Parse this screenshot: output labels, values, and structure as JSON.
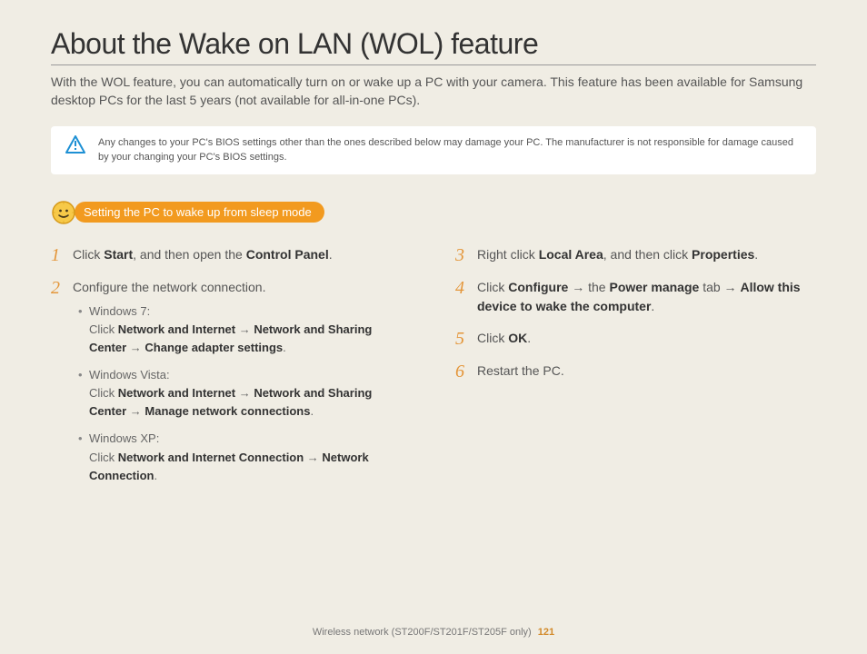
{
  "title": "About the Wake on LAN (WOL) feature",
  "intro": "With the WOL feature, you can automatically turn on or wake up a PC with your camera. This feature has been available for Samsung desktop PCs for the last 5 years (not available for all-in-one PCs).",
  "warning": "Any changes to your PC's BIOS settings other than the ones described below may damage your PC. The manufacturer is not responsible for damage caused by your changing your PC's BIOS settings.",
  "section_heading": "Setting the PC to wake up from sleep mode",
  "left_steps": {
    "s1": {
      "num": "1",
      "pre": "Click ",
      "b1": "Start",
      "mid": ", and then open the ",
      "b2": "Control Panel",
      "post": "."
    },
    "s2": {
      "num": "2",
      "text": "Configure the network connection.",
      "subs": [
        {
          "os": "Windows 7:",
          "pre": "Click ",
          "b1": "Network and Internet",
          "a1": " → ",
          "b2": "Network and Sharing Center",
          "a2": " → ",
          "b3": "Change adapter settings",
          "post": "."
        },
        {
          "os": "Windows Vista:",
          "pre": "Click ",
          "b1": "Network and Internet",
          "a1": " → ",
          "b2": "Network and Sharing Center",
          "a2": " → ",
          "b3": "Manage network connections",
          "post": "."
        },
        {
          "os": "Windows XP:",
          "pre": "Click ",
          "b1": "Network and Internet Connection",
          "a1": " → ",
          "b2": "Network Connection",
          "a2": "",
          "b3": "",
          "post": "."
        }
      ]
    }
  },
  "right_steps": {
    "s3": {
      "num": "3",
      "pre": "Right click ",
      "b1": "Local Area",
      "mid": ", and then click ",
      "b2": "Properties",
      "post": "."
    },
    "s4": {
      "num": "4",
      "pre": "Click ",
      "b1": "Configure",
      "a1": " → the ",
      "b2": "Power manage",
      "a2": " tab → ",
      "b3": "Allow this device to wake the computer",
      "post": "."
    },
    "s5": {
      "num": "5",
      "pre": "Click ",
      "b1": "OK",
      "post": "."
    },
    "s6": {
      "num": "6",
      "text": "Restart the PC."
    }
  },
  "footer": {
    "section": "Wireless network (ST200F/ST201F/ST205F only)",
    "page": "121"
  }
}
